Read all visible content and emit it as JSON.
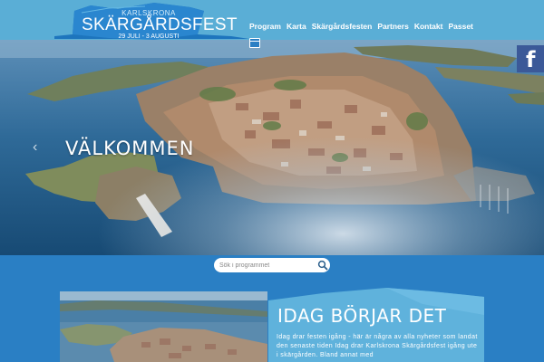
{
  "header": {
    "logo": {
      "city": "KARLSKRONA",
      "name": "SKÄRGÅRDSFEST",
      "dates": "29 JULI - 3 AUGUSTI"
    },
    "nav": [
      {
        "label": "Program"
      },
      {
        "label": "Karta"
      },
      {
        "label": "Skärgårdsfesten"
      },
      {
        "label": "Partners"
      },
      {
        "label": "Kontakt"
      },
      {
        "label": "Passet"
      }
    ],
    "calendar_icon": "calendar-icon"
  },
  "hero": {
    "title": "VÄLKOMMEN",
    "prev_arrow": "‹",
    "social": {
      "label": "f",
      "icon": "facebook-icon"
    }
  },
  "search": {
    "placeholder": "Sök i programmet",
    "icon": "search-icon"
  },
  "article": {
    "title": "IDAG BÖRJAR DET",
    "text": "Idag drar festen igång - här är några av alla nyheter som landat den senaste tiden Idag drar Karlskrona Skärgårdsfest igång ute i skärgården. Bland annat med"
  },
  "colors": {
    "topbar": "#5aaed6",
    "band": "#2a7fc4",
    "logo_blue": "#1d75bd",
    "panel": "#5fb2dc",
    "facebook": "#3b5998"
  }
}
